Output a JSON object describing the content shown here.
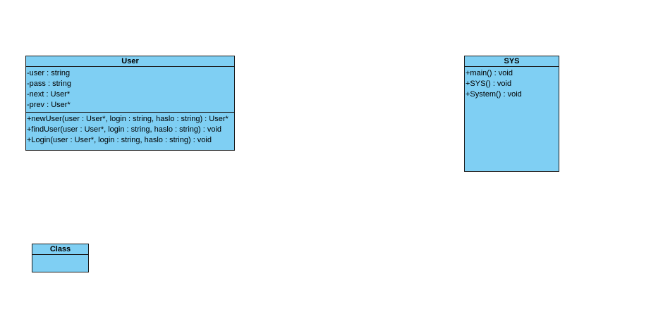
{
  "diagram": {
    "fill_color": "#7fcff3",
    "border_color": "#1a1a1a",
    "classes": [
      {
        "name": "User",
        "attributes": [
          "-user : string",
          "-pass : string",
          "-next : User*",
          "-prev : User*"
        ],
        "operations": [
          "+newUser(user : User*, login : string, haslo : string) : User*",
          "+findUser(user : User*, login : string, haslo : string) : void",
          "+Login(user : User*, login : string, haslo : string) : void"
        ]
      },
      {
        "name": "SYS",
        "attributes": [],
        "operations": [
          "+main() : void",
          "+SYS() : void",
          "+System() : void"
        ]
      },
      {
        "name": "Class",
        "attributes": [],
        "operations": []
      }
    ]
  }
}
